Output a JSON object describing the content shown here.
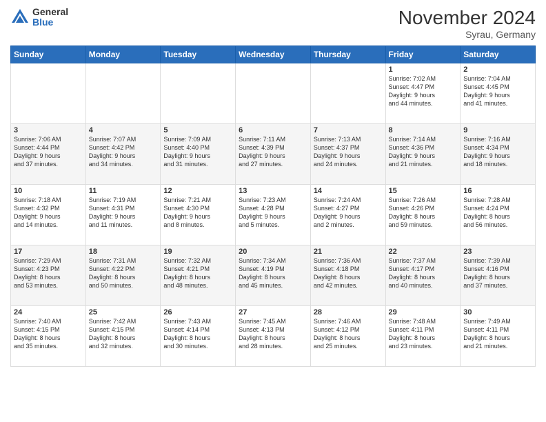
{
  "header": {
    "logo_general": "General",
    "logo_blue": "Blue",
    "month_title": "November 2024",
    "location": "Syrau, Germany"
  },
  "days_of_week": [
    "Sunday",
    "Monday",
    "Tuesday",
    "Wednesday",
    "Thursday",
    "Friday",
    "Saturday"
  ],
  "weeks": [
    [
      {
        "day": "",
        "info": ""
      },
      {
        "day": "",
        "info": ""
      },
      {
        "day": "",
        "info": ""
      },
      {
        "day": "",
        "info": ""
      },
      {
        "day": "",
        "info": ""
      },
      {
        "day": "1",
        "info": "Sunrise: 7:02 AM\nSunset: 4:47 PM\nDaylight: 9 hours\nand 44 minutes."
      },
      {
        "day": "2",
        "info": "Sunrise: 7:04 AM\nSunset: 4:45 PM\nDaylight: 9 hours\nand 41 minutes."
      }
    ],
    [
      {
        "day": "3",
        "info": "Sunrise: 7:06 AM\nSunset: 4:44 PM\nDaylight: 9 hours\nand 37 minutes."
      },
      {
        "day": "4",
        "info": "Sunrise: 7:07 AM\nSunset: 4:42 PM\nDaylight: 9 hours\nand 34 minutes."
      },
      {
        "day": "5",
        "info": "Sunrise: 7:09 AM\nSunset: 4:40 PM\nDaylight: 9 hours\nand 31 minutes."
      },
      {
        "day": "6",
        "info": "Sunrise: 7:11 AM\nSunset: 4:39 PM\nDaylight: 9 hours\nand 27 minutes."
      },
      {
        "day": "7",
        "info": "Sunrise: 7:13 AM\nSunset: 4:37 PM\nDaylight: 9 hours\nand 24 minutes."
      },
      {
        "day": "8",
        "info": "Sunrise: 7:14 AM\nSunset: 4:36 PM\nDaylight: 9 hours\nand 21 minutes."
      },
      {
        "day": "9",
        "info": "Sunrise: 7:16 AM\nSunset: 4:34 PM\nDaylight: 9 hours\nand 18 minutes."
      }
    ],
    [
      {
        "day": "10",
        "info": "Sunrise: 7:18 AM\nSunset: 4:32 PM\nDaylight: 9 hours\nand 14 minutes."
      },
      {
        "day": "11",
        "info": "Sunrise: 7:19 AM\nSunset: 4:31 PM\nDaylight: 9 hours\nand 11 minutes."
      },
      {
        "day": "12",
        "info": "Sunrise: 7:21 AM\nSunset: 4:30 PM\nDaylight: 9 hours\nand 8 minutes."
      },
      {
        "day": "13",
        "info": "Sunrise: 7:23 AM\nSunset: 4:28 PM\nDaylight: 9 hours\nand 5 minutes."
      },
      {
        "day": "14",
        "info": "Sunrise: 7:24 AM\nSunset: 4:27 PM\nDaylight: 9 hours\nand 2 minutes."
      },
      {
        "day": "15",
        "info": "Sunrise: 7:26 AM\nSunset: 4:26 PM\nDaylight: 8 hours\nand 59 minutes."
      },
      {
        "day": "16",
        "info": "Sunrise: 7:28 AM\nSunset: 4:24 PM\nDaylight: 8 hours\nand 56 minutes."
      }
    ],
    [
      {
        "day": "17",
        "info": "Sunrise: 7:29 AM\nSunset: 4:23 PM\nDaylight: 8 hours\nand 53 minutes."
      },
      {
        "day": "18",
        "info": "Sunrise: 7:31 AM\nSunset: 4:22 PM\nDaylight: 8 hours\nand 50 minutes."
      },
      {
        "day": "19",
        "info": "Sunrise: 7:32 AM\nSunset: 4:21 PM\nDaylight: 8 hours\nand 48 minutes."
      },
      {
        "day": "20",
        "info": "Sunrise: 7:34 AM\nSunset: 4:19 PM\nDaylight: 8 hours\nand 45 minutes."
      },
      {
        "day": "21",
        "info": "Sunrise: 7:36 AM\nSunset: 4:18 PM\nDaylight: 8 hours\nand 42 minutes."
      },
      {
        "day": "22",
        "info": "Sunrise: 7:37 AM\nSunset: 4:17 PM\nDaylight: 8 hours\nand 40 minutes."
      },
      {
        "day": "23",
        "info": "Sunrise: 7:39 AM\nSunset: 4:16 PM\nDaylight: 8 hours\nand 37 minutes."
      }
    ],
    [
      {
        "day": "24",
        "info": "Sunrise: 7:40 AM\nSunset: 4:15 PM\nDaylight: 8 hours\nand 35 minutes."
      },
      {
        "day": "25",
        "info": "Sunrise: 7:42 AM\nSunset: 4:15 PM\nDaylight: 8 hours\nand 32 minutes."
      },
      {
        "day": "26",
        "info": "Sunrise: 7:43 AM\nSunset: 4:14 PM\nDaylight: 8 hours\nand 30 minutes."
      },
      {
        "day": "27",
        "info": "Sunrise: 7:45 AM\nSunset: 4:13 PM\nDaylight: 8 hours\nand 28 minutes."
      },
      {
        "day": "28",
        "info": "Sunrise: 7:46 AM\nSunset: 4:12 PM\nDaylight: 8 hours\nand 25 minutes."
      },
      {
        "day": "29",
        "info": "Sunrise: 7:48 AM\nSunset: 4:11 PM\nDaylight: 8 hours\nand 23 minutes."
      },
      {
        "day": "30",
        "info": "Sunrise: 7:49 AM\nSunset: 4:11 PM\nDaylight: 8 hours\nand 21 minutes."
      }
    ]
  ]
}
